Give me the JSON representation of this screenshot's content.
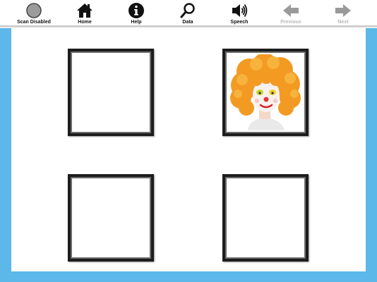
{
  "toolbar": {
    "scan": {
      "label": "Scan Disabled",
      "icon": "circle-icon"
    },
    "home": {
      "label": "Home",
      "icon": "home-icon"
    },
    "help": {
      "label": "Help",
      "icon": "info-icon"
    },
    "data": {
      "label": "Data",
      "icon": "search-icon"
    },
    "speech": {
      "label": "Speech",
      "icon": "speaker-icon"
    },
    "previous": {
      "label": "Previous",
      "icon": "arrow-left-icon",
      "disabled": true
    },
    "next": {
      "label": "Next",
      "icon": "arrow-right-icon",
      "disabled": true
    }
  },
  "colors": {
    "frame": "#5bb8e8",
    "tile_border": "#1c1c1c",
    "disabled_icon": "#9a9a9a"
  },
  "grid": {
    "tiles": [
      {
        "content": "empty"
      },
      {
        "content": "image",
        "image": "clown-wig-face"
      },
      {
        "content": "empty"
      },
      {
        "content": "empty"
      }
    ]
  }
}
